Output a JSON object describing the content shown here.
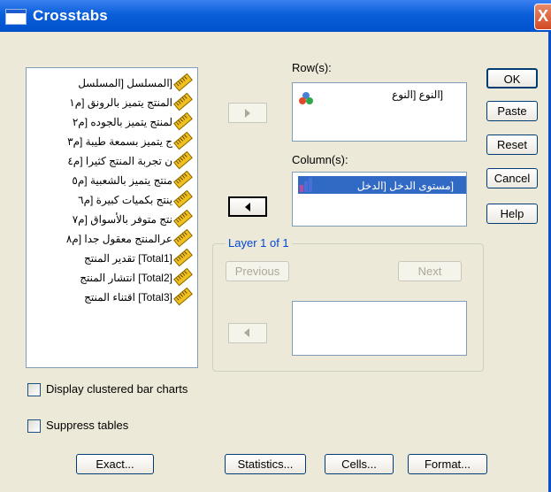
{
  "window": {
    "title": "Crosstabs",
    "close_glyph": "X"
  },
  "variables": [
    "[المسلسل [المسلسل",
    "المنتج يتميز بالرونق [م١",
    "لمنتج يتميز بالجوده [م٢",
    "ج يتميز بسمعة طيبة [م٣",
    "ن تجربة المنتج كثيرا [م٤",
    "منتج يتميز بالشعبية [م٥",
    "ينتج بكميات كبيرة [م٦",
    "نتج متوفر بالأسواق [م٧",
    "عرالمنتج معقول جدا [م٨",
    "[Total1] تقدير المنتج",
    "[Total2] انتشار المنتج",
    "[Total3] اقتناء المنتج"
  ],
  "rows": {
    "label": "Row(s):",
    "items": [
      "[النوع [النوع"
    ]
  },
  "columns": {
    "label": "Column(s):",
    "items": [
      "[مستوى الدخل [الدخل"
    ]
  },
  "layer": {
    "title": "Layer 1 of 1",
    "previous": "Previous",
    "next": "Next"
  },
  "buttons": {
    "ok": "OK",
    "paste": "Paste",
    "reset": "Reset",
    "cancel": "Cancel",
    "help": "Help"
  },
  "options": {
    "clustered": "Display clustered bar charts",
    "suppress": "Suppress tables"
  },
  "bottom": {
    "exact": "Exact...",
    "statistics": "Statistics...",
    "cells": "Cells...",
    "format": "Format..."
  },
  "icons": {
    "variable": "scale-ruler-icon",
    "nominal": "nominal-circles-icon",
    "ordinal": "ordinal-bars-icon"
  }
}
